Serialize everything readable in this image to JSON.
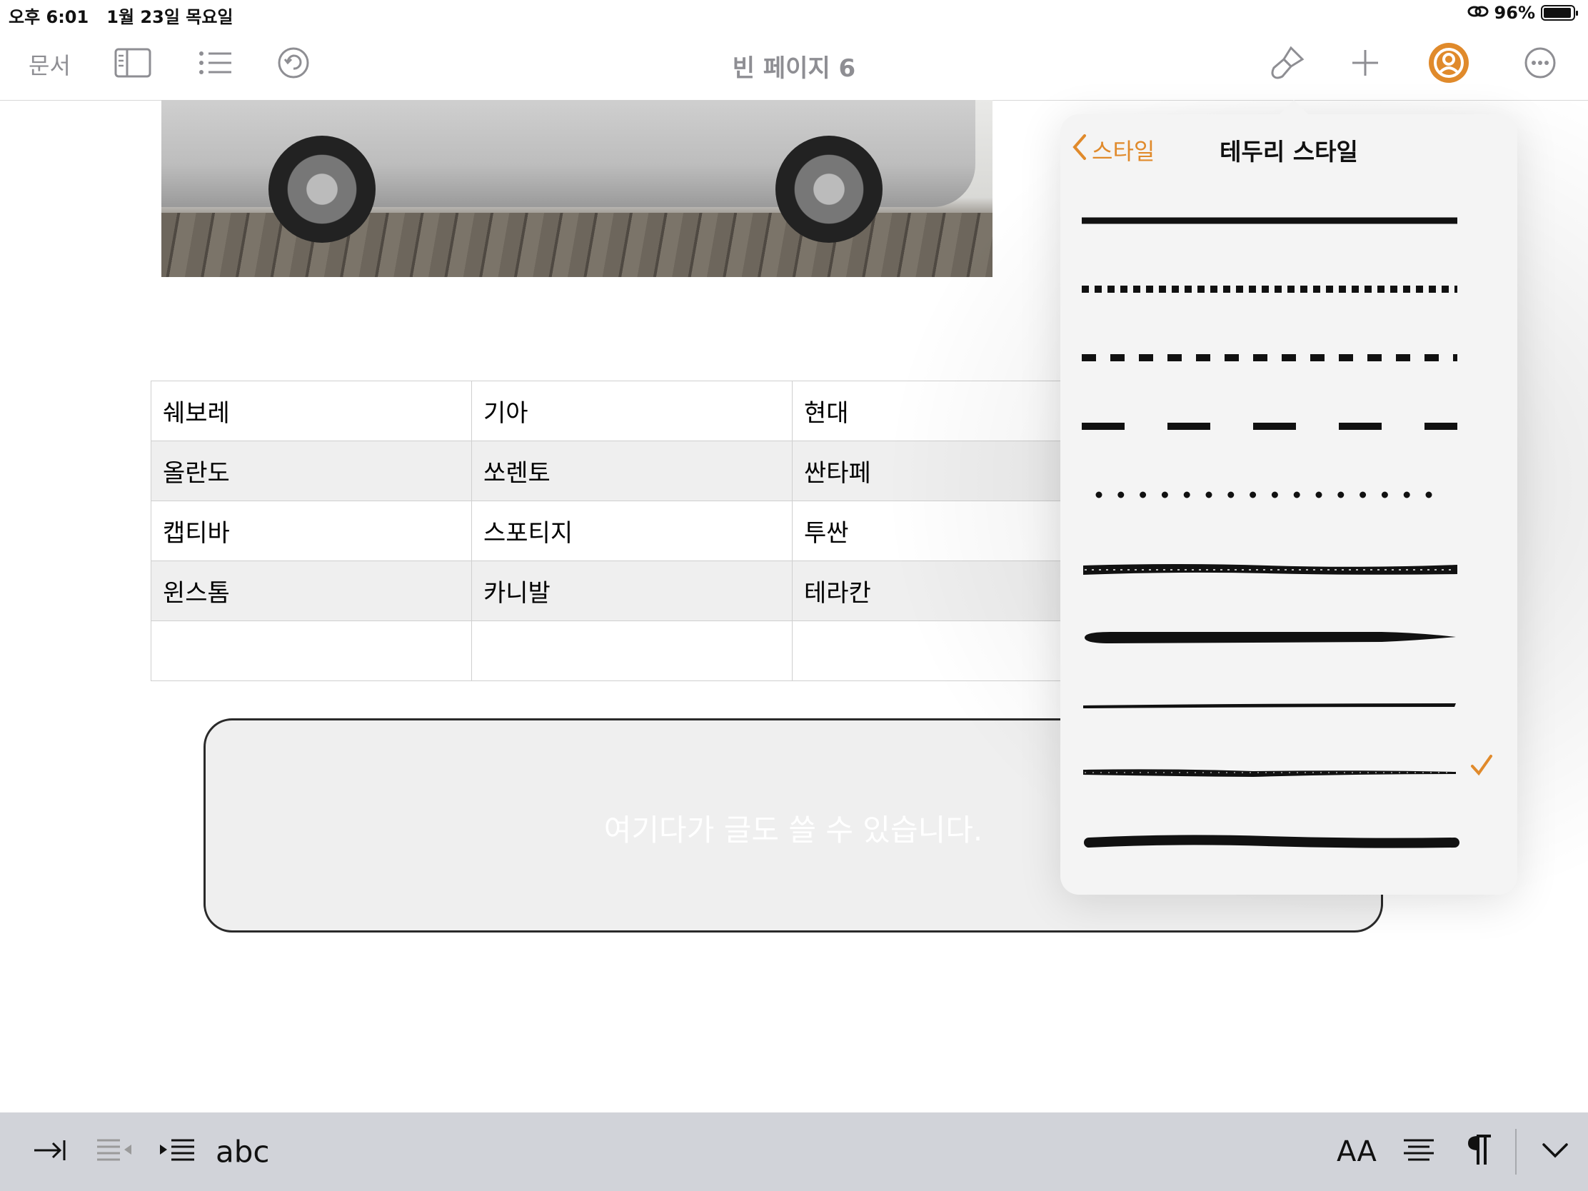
{
  "status_bar": {
    "time": "오후 6:01",
    "date": "1월 23일 목요일",
    "battery": "96%"
  },
  "toolbar": {
    "docs_label": "문서",
    "title": "빈 페이지 6"
  },
  "table": {
    "rows": [
      [
        "쉐보레",
        "기아",
        "현대"
      ],
      [
        "올란도",
        "쏘렌토",
        "싼타페"
      ],
      [
        "캡티바",
        "스포티지",
        "투싼"
      ],
      [
        "윈스톰",
        "카니발",
        "테라칸"
      ],
      [
        "",
        "",
        ""
      ]
    ]
  },
  "textbox": {
    "text": "여기다가 글도 쓸 수 있습니다."
  },
  "popover": {
    "back_label": "스타일",
    "title": "테두리 스타일",
    "styles": [
      "solid",
      "dotted-square",
      "dashed-short",
      "dashed-long",
      "dotted-round",
      "brush-rough",
      "brush-taper",
      "pencil-thin",
      "brush-dry",
      "crayon-round"
    ],
    "selected_index": 8
  },
  "bottom_bar": {
    "spellcheck_label": "abc",
    "font_size_label": "AA"
  },
  "colors": {
    "accent": "#e08a2b"
  }
}
